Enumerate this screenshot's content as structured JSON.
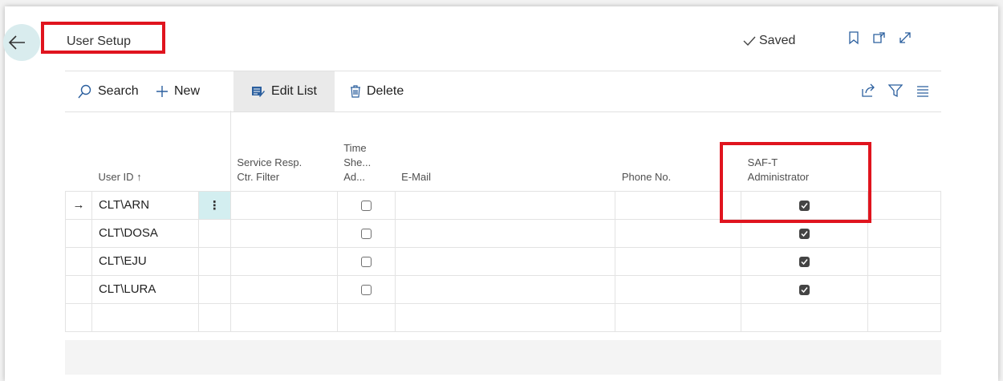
{
  "header": {
    "title": "User Setup",
    "status": "Saved"
  },
  "toolbar": {
    "search_label": "Search",
    "new_label": "New",
    "edit_list_label": "Edit List",
    "delete_label": "Delete"
  },
  "table": {
    "columns": {
      "user_id": "User ID",
      "service_filter_line1": "Service Resp.",
      "service_filter_line2": "Ctr. Filter",
      "time_sheet_line1": "Time",
      "time_sheet_line2": "She...",
      "time_sheet_line3": "Ad...",
      "email": "E-Mail",
      "phone": "Phone No.",
      "saft_line1": "SAF-T",
      "saft_line2": "Administrator"
    },
    "rows": [
      {
        "user_id": "CLT\\ARN",
        "time_sheet_admin": false,
        "saft_admin": true
      },
      {
        "user_id": "CLT\\DOSA",
        "time_sheet_admin": false,
        "saft_admin": true
      },
      {
        "user_id": "CLT\\EJU",
        "time_sheet_admin": false,
        "saft_admin": true
      },
      {
        "user_id": "CLT\\LURA",
        "time_sheet_admin": false,
        "saft_admin": true
      }
    ]
  },
  "colors": {
    "highlight": "#e0141e",
    "selection": "#d3eef0",
    "accent": "#2b5f9e"
  }
}
